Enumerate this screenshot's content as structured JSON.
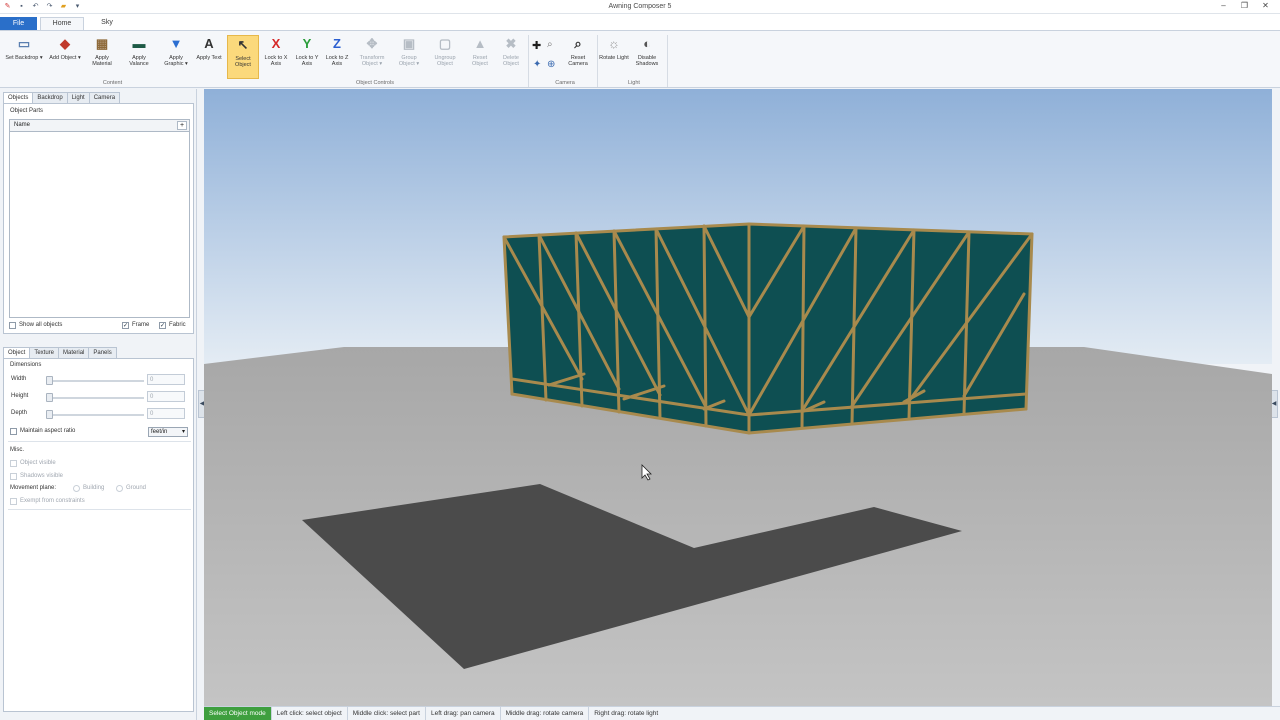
{
  "window": {
    "title": "Awning Composer 5",
    "qat_icons": [
      "app-icon",
      "save-icon",
      "undo-icon",
      "redo-icon",
      "open-icon",
      "customize-icon"
    ],
    "controls": [
      "–",
      "❐",
      "✕"
    ]
  },
  "ribbon_tabs": [
    "File",
    "Home",
    "Sky"
  ],
  "ribbon": {
    "buttons": [
      {
        "id": "set-backdrop",
        "label": "Set Backdrop ▾",
        "icon": "▭",
        "color": "#5a7fb0"
      },
      {
        "id": "add-object",
        "label": "Add Object ▾",
        "icon": "◆",
        "color": "#c0392b"
      },
      {
        "id": "apply-material",
        "label": "Apply Material",
        "icon": "▦",
        "color": "#8e6a3a"
      },
      {
        "id": "apply-valance",
        "label": "Apply Valance",
        "icon": "▬",
        "color": "#1e5a46"
      },
      {
        "id": "apply-graphic",
        "label": "Apply Graphic ▾",
        "icon": "▼",
        "color": "#2b6ed1"
      },
      {
        "id": "apply-text",
        "label": "Apply Text",
        "icon": "A",
        "color": "#333333"
      },
      {
        "id": "select-object",
        "label": "Select Object",
        "icon": "↖",
        "color": "#333333"
      },
      {
        "id": "lock-x",
        "label": "Lock to X Axis",
        "icon": "X",
        "color": "#d62828"
      },
      {
        "id": "lock-y",
        "label": "Lock to Y Axis",
        "icon": "Y",
        "color": "#2a9d3a"
      },
      {
        "id": "lock-z",
        "label": "Lock to Z Axis",
        "icon": "Z",
        "color": "#2b5fd1"
      },
      {
        "id": "transform-object",
        "label": "Transform Object ▾",
        "icon": "✥",
        "color": "#9aa3ad"
      },
      {
        "id": "group-object",
        "label": "Group Object ▾",
        "icon": "▣",
        "color": "#9aa3ad"
      },
      {
        "id": "ungroup-object",
        "label": "Ungroup Object",
        "icon": "▢",
        "color": "#9aa3ad"
      },
      {
        "id": "reset-object",
        "label": "Reset Object",
        "icon": "▲",
        "color": "#9aa3ad"
      },
      {
        "id": "delete-object",
        "label": "Delete Object",
        "icon": "✖",
        "color": "#9aa3ad"
      },
      {
        "id": "reset-camera",
        "label": "Reset Camera",
        "icon": "⌕",
        "color": "#333333"
      },
      {
        "id": "rotate-light",
        "label": "Rotate Light",
        "icon": "☼",
        "color": "#555555"
      },
      {
        "id": "disable-shadows",
        "label": "Disable Shadows",
        "icon": "◐",
        "color": "#555555"
      }
    ],
    "camera_small_icons": [
      "✚",
      "⌕",
      "✦",
      "⊕"
    ],
    "groups": [
      "Content",
      "Object Controls",
      "Camera",
      "Light"
    ]
  },
  "objects_panel": {
    "tabs": [
      "Objects",
      "Backdrop",
      "Light",
      "Camera"
    ],
    "section_label": "Object Parts",
    "list_header": "Name",
    "add_button": "+",
    "show_all": "Show all objects",
    "frame": "Frame",
    "fabric": "Fabric"
  },
  "properties_panel": {
    "tabs": [
      "Object",
      "Texture",
      "Material",
      "Panels"
    ],
    "dimensions_label": "Dimensions",
    "width_label": "Width",
    "height_label": "Height",
    "depth_label": "Depth",
    "width_value": "0",
    "height_value": "0",
    "depth_value": "0",
    "maintain_aspect": "Maintain aspect ratio",
    "units": "feet/in",
    "misc_label": "Misc.",
    "object_visible": "Object visible",
    "shadows_visible": "Shadows visible",
    "movement_plane": "Movement plane:",
    "building": "Building",
    "ground": "Ground",
    "exempt": "Exempt from constraints"
  },
  "viewport": {
    "sky_top": "#8fb0d8",
    "sky_bottom": "#e4ecf4",
    "ground": "#a9a9a9",
    "fabric": "#0e4f52",
    "frame": "#a88a4d",
    "shadow": "#4b4b4b"
  },
  "statusbar": {
    "mode": "Select Object mode",
    "items": [
      "Left click: select object",
      "Middle click: select part",
      "Left drag: pan camera",
      "Middle drag: rotate camera",
      "Right drag: rotate light"
    ]
  }
}
